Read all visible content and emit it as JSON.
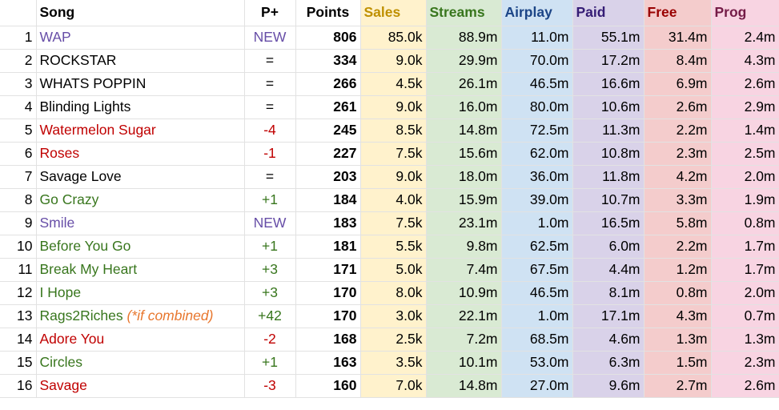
{
  "colors": {
    "sales_bg": "#fff2cc",
    "streams_bg": "#d9ead3",
    "airplay_bg": "#cfe2f3",
    "paid_bg": "#d9d2e9",
    "free_bg": "#f4cccc",
    "prog_bg": "#f8d4e2",
    "sales_head": "#bf9000",
    "streams_head": "#38761d",
    "airplay_head": "#1c4587",
    "paid_head": "#351c75",
    "free_head": "#990000",
    "prog_head": "#741b47",
    "new": "#674ea7",
    "up": "#38761d",
    "down": "#c00000",
    "same": "#000000"
  },
  "headers": [
    "Song",
    "P+",
    "Points",
    "Sales",
    "Streams",
    "Airplay",
    "Paid",
    "Free",
    "Prog"
  ],
  "rows": [
    {
      "rank": "1",
      "song": "WAP",
      "note": "",
      "change": "NEW",
      "trend": "new",
      "points": "806",
      "sales": "85.0k",
      "streams": "88.9m",
      "airplay": "11.0m",
      "paid": "55.1m",
      "free": "31.4m",
      "prog": "2.4m"
    },
    {
      "rank": "2",
      "song": "ROCKSTAR",
      "note": "",
      "change": "=",
      "trend": "same",
      "points": "334",
      "sales": "9.0k",
      "streams": "29.9m",
      "airplay": "70.0m",
      "paid": "17.2m",
      "free": "8.4m",
      "prog": "4.3m"
    },
    {
      "rank": "3",
      "song": "WHATS POPPIN",
      "note": "",
      "change": "=",
      "trend": "same",
      "points": "266",
      "sales": "4.5k",
      "streams": "26.1m",
      "airplay": "46.5m",
      "paid": "16.6m",
      "free": "6.9m",
      "prog": "2.6m"
    },
    {
      "rank": "4",
      "song": "Blinding Lights",
      "note": "",
      "change": "=",
      "trend": "same",
      "points": "261",
      "sales": "9.0k",
      "streams": "16.0m",
      "airplay": "80.0m",
      "paid": "10.6m",
      "free": "2.6m",
      "prog": "2.9m"
    },
    {
      "rank": "5",
      "song": "Watermelon Sugar",
      "note": "",
      "change": "-4",
      "trend": "down",
      "points": "245",
      "sales": "8.5k",
      "streams": "14.8m",
      "airplay": "72.5m",
      "paid": "11.3m",
      "free": "2.2m",
      "prog": "1.4m"
    },
    {
      "rank": "6",
      "song": "Roses",
      "note": "",
      "change": "-1",
      "trend": "down",
      "points": "227",
      "sales": "7.5k",
      "streams": "15.6m",
      "airplay": "62.0m",
      "paid": "10.8m",
      "free": "2.3m",
      "prog": "2.5m"
    },
    {
      "rank": "7",
      "song": "Savage Love",
      "note": "",
      "change": "=",
      "trend": "same",
      "points": "203",
      "sales": "9.0k",
      "streams": "18.0m",
      "airplay": "36.0m",
      "paid": "11.8m",
      "free": "4.2m",
      "prog": "2.0m"
    },
    {
      "rank": "8",
      "song": "Go Crazy",
      "note": "",
      "change": "+1",
      "trend": "up",
      "points": "184",
      "sales": "4.0k",
      "streams": "15.9m",
      "airplay": "39.0m",
      "paid": "10.7m",
      "free": "3.3m",
      "prog": "1.9m"
    },
    {
      "rank": "9",
      "song": "Smile",
      "note": "",
      "change": "NEW",
      "trend": "new",
      "points": "183",
      "sales": "7.5k",
      "streams": "23.1m",
      "airplay": "1.0m",
      "paid": "16.5m",
      "free": "5.8m",
      "prog": "0.8m"
    },
    {
      "rank": "10",
      "song": "Before You Go",
      "note": "",
      "change": "+1",
      "trend": "up",
      "points": "181",
      "sales": "5.5k",
      "streams": "9.8m",
      "airplay": "62.5m",
      "paid": "6.0m",
      "free": "2.2m",
      "prog": "1.7m"
    },
    {
      "rank": "11",
      "song": "Break My Heart",
      "note": "",
      "change": "+3",
      "trend": "up",
      "points": "171",
      "sales": "5.0k",
      "streams": "7.4m",
      "airplay": "67.5m",
      "paid": "4.4m",
      "free": "1.2m",
      "prog": "1.7m"
    },
    {
      "rank": "12",
      "song": "I Hope",
      "note": "",
      "change": "+3",
      "trend": "up",
      "points": "170",
      "sales": "8.0k",
      "streams": "10.9m",
      "airplay": "46.5m",
      "paid": "8.1m",
      "free": "0.8m",
      "prog": "2.0m"
    },
    {
      "rank": "13",
      "song": "Rags2Riches",
      "note": "(*if combined)",
      "change": "+42",
      "trend": "up",
      "points": "170",
      "sales": "3.0k",
      "streams": "22.1m",
      "airplay": "1.0m",
      "paid": "17.1m",
      "free": "4.3m",
      "prog": "0.7m"
    },
    {
      "rank": "14",
      "song": "Adore You",
      "note": "",
      "change": "-2",
      "trend": "down",
      "points": "168",
      "sales": "2.5k",
      "streams": "7.2m",
      "airplay": "68.5m",
      "paid": "4.6m",
      "free": "1.3m",
      "prog": "1.3m"
    },
    {
      "rank": "15",
      "song": "Circles",
      "note": "",
      "change": "+1",
      "trend": "up",
      "points": "163",
      "sales": "3.5k",
      "streams": "10.1m",
      "airplay": "53.0m",
      "paid": "6.3m",
      "free": "1.5m",
      "prog": "2.3m"
    },
    {
      "rank": "16",
      "song": "Savage",
      "note": "",
      "change": "-3",
      "trend": "down",
      "points": "160",
      "sales": "7.0k",
      "streams": "14.8m",
      "airplay": "27.0m",
      "paid": "9.6m",
      "free": "2.7m",
      "prog": "2.6m"
    }
  ]
}
